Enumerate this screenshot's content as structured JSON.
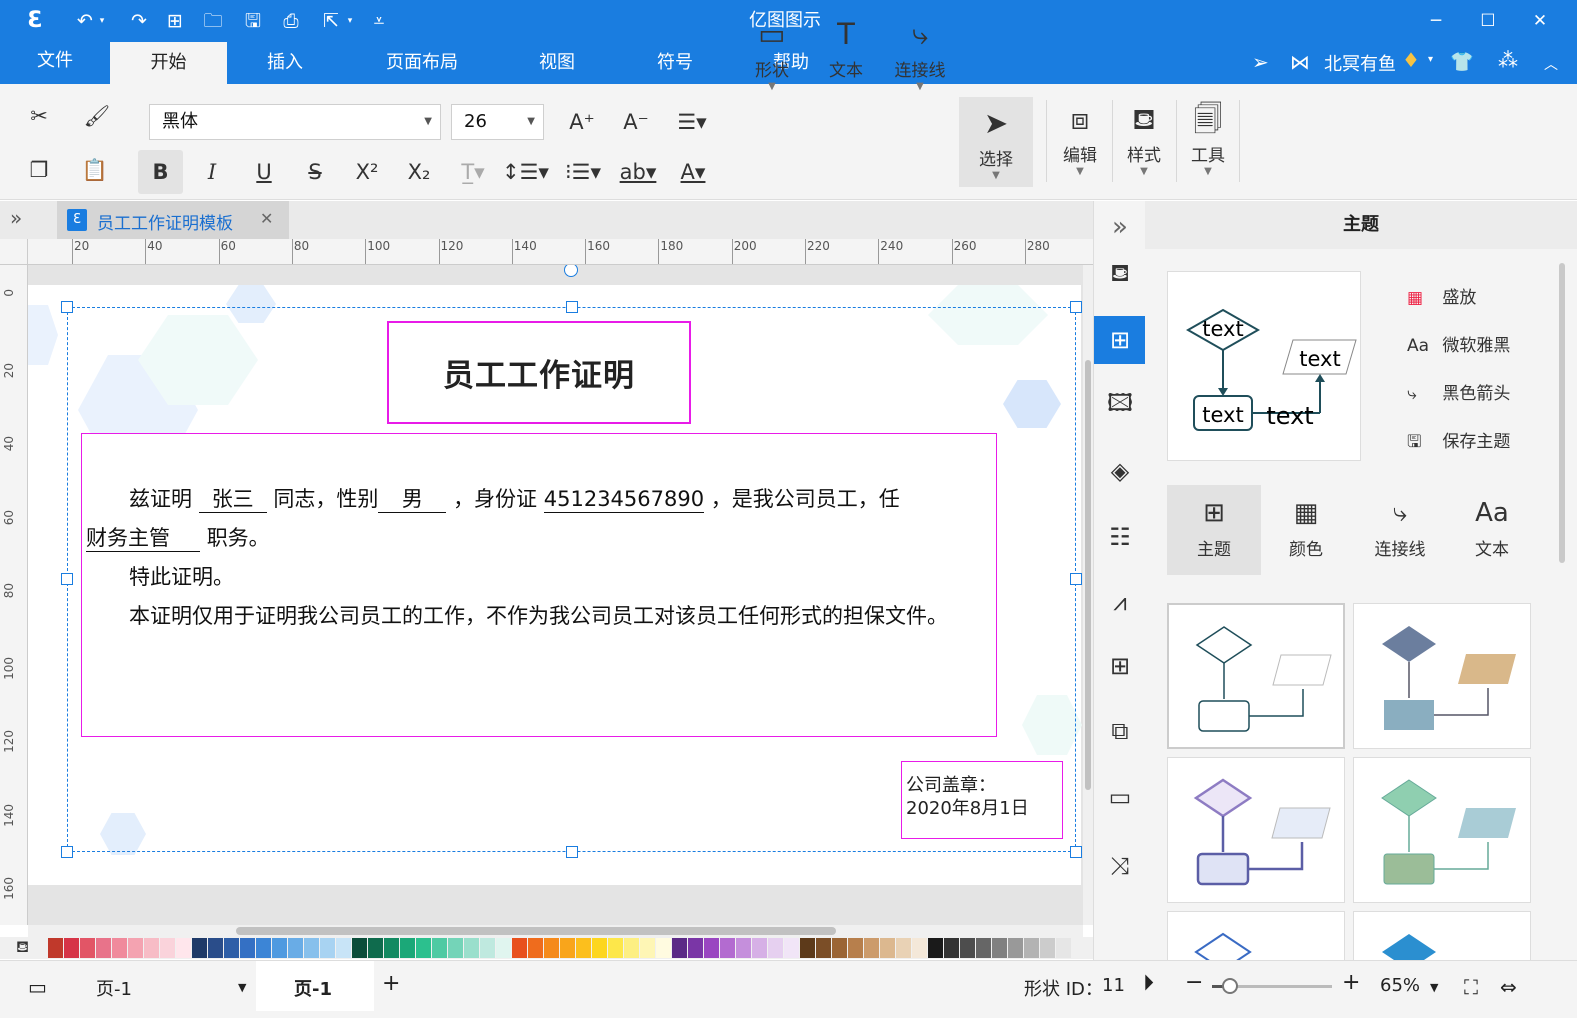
{
  "app": {
    "title": "亿图图示"
  },
  "quick_access": [
    "logo-icon",
    "undo-icon",
    "redo-icon",
    "new-icon",
    "open-icon",
    "save-icon",
    "print-icon",
    "export-icon",
    "customize-icon"
  ],
  "window_controls": [
    "minimize-icon",
    "maximize-icon",
    "close-icon"
  ],
  "menu": {
    "tabs": [
      "文件",
      "开始",
      "插入",
      "页面布局",
      "视图",
      "符号",
      "帮助"
    ],
    "active": "开始",
    "user": "北冥有鱼"
  },
  "ribbon": {
    "font_family": "黑体",
    "font_size": "26",
    "big_buttons": [
      {
        "label": "形状"
      },
      {
        "label": "文本"
      },
      {
        "label": "连接线"
      },
      {
        "label": "选择"
      },
      {
        "label": "编辑"
      },
      {
        "label": "样式"
      },
      {
        "label": "工具"
      }
    ]
  },
  "doc_tab": {
    "title": "员工工作证明模板"
  },
  "ruler": {
    "h_ticks": [
      "20",
      "40",
      "60",
      "80",
      "100",
      "120",
      "140",
      "160",
      "180",
      "200",
      "220",
      "240",
      "260",
      "280"
    ],
    "v_ticks": [
      "0",
      "20",
      "40",
      "60",
      "80",
      "100",
      "120",
      "140",
      "160"
    ]
  },
  "document": {
    "title": "员工工作证明",
    "body_p1_a": "兹证明",
    "name": "张三",
    "body_p1_b": "同志，性别",
    "gender": "男",
    "body_p1_c": "，身份证",
    "id_number": "451234567890",
    "body_p1_d": "，是我公司员工，任",
    "position": "财务主管",
    "body_p1_e": "职务。",
    "body_p2": "特此证明。",
    "body_p3": "本证明仅用于证明我公司员工的工作，不作为我公司员工对该员工任何形式的担保文件。",
    "stamp_label": "公司盖章：",
    "stamp_date": "2020年8月1日"
  },
  "right_strip": [
    "fill-icon",
    "theme-icon",
    "image-icon",
    "layers-icon",
    "page-icon",
    "chart-icon",
    "table-icon",
    "outline-icon",
    "presentation-icon",
    "shuffle-icon"
  ],
  "theme_panel": {
    "title": "主题",
    "preview_texts": [
      "text",
      "text",
      "text",
      "text"
    ],
    "options": [
      {
        "label": "盛放"
      },
      {
        "label": "微软雅黑"
      },
      {
        "label": "黑色箭头"
      },
      {
        "label": "保存主题"
      }
    ],
    "subtabs": [
      {
        "label": "主题"
      },
      {
        "label": "颜色"
      },
      {
        "label": "连接线"
      },
      {
        "label": "文本"
      }
    ]
  },
  "palette_colors": [
    "#c0392b",
    "#d63447",
    "#e25566",
    "#e8738a",
    "#f08a9c",
    "#f4a3b1",
    "#f7bcc6",
    "#fad3db",
    "#ffe6ec",
    "#1f3a68",
    "#2a4d8a",
    "#2e5ea7",
    "#3470c4",
    "#3c85d6",
    "#4f9ae0",
    "#69ace6",
    "#87c0ec",
    "#a8d3f2",
    "#c8e4f7",
    "#0b4d3a",
    "#0f6b4d",
    "#138a62",
    "#1ba878",
    "#2cc08e",
    "#4fcaa3",
    "#74d4b8",
    "#9adfcc",
    "#bfe9df",
    "#e0f5ef",
    "#e8501d",
    "#ef6c1d",
    "#f58a1b",
    "#f9a51b",
    "#fcbf1d",
    "#fdd61f",
    "#fde74a",
    "#fdef82",
    "#fef6b5",
    "#fffbe0",
    "#5b2a86",
    "#7a36a6",
    "#9a46c1",
    "#b36bd0",
    "#c58fdc",
    "#d6b0e6",
    "#e6d0f0",
    "#f1e5f7",
    "#5d3a1a",
    "#7b4e27",
    "#9b6535",
    "#b77f4c",
    "#cc9b6b",
    "#dcb88f",
    "#e9d2b5",
    "#f4e8d9",
    "#1a1a1a",
    "#333333",
    "#4d4d4d",
    "#666666",
    "#808080",
    "#999999",
    "#b3b3b3",
    "#cccccc",
    "#e6e6e6"
  ],
  "status": {
    "page_selector": "页-1",
    "page_tab": "页-1",
    "shape_id_label": "形状 ID：",
    "shape_id": "11",
    "zoom": "65%",
    "zoom_level": 0.15
  }
}
